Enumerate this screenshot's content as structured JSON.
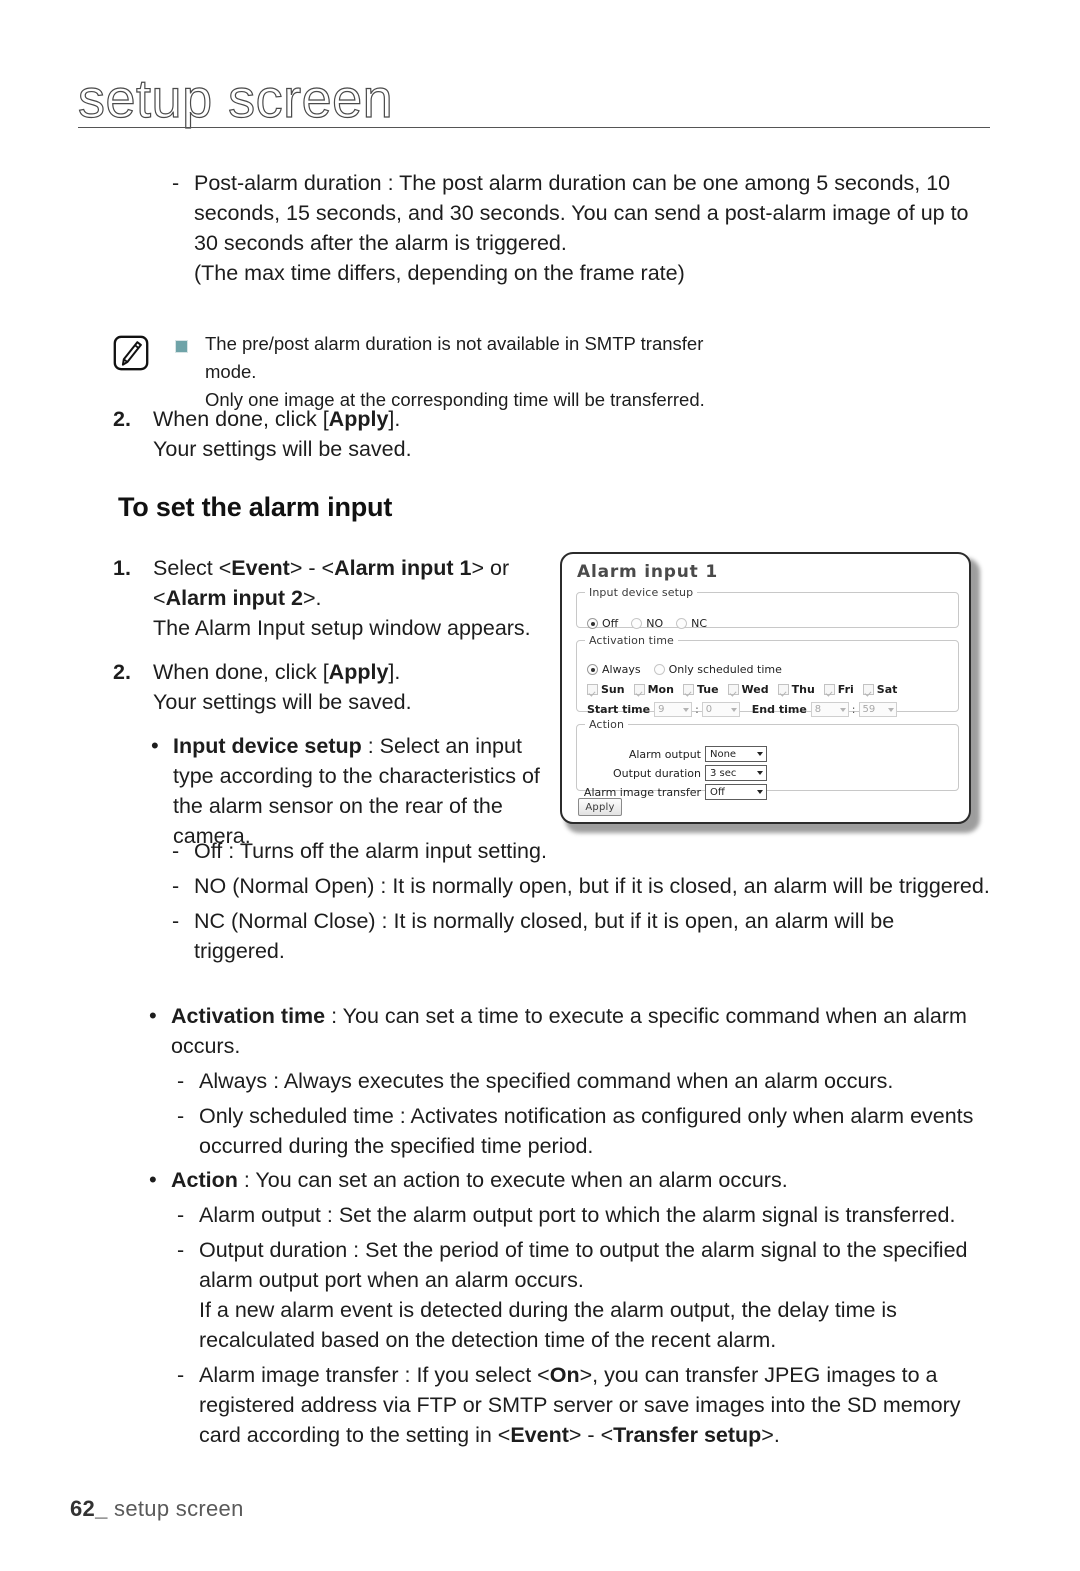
{
  "header": {
    "title": "setup screen"
  },
  "post_alarm": {
    "dash": "-",
    "line1": "Post-alarm duration : The post alarm duration can be one among 5 seconds, 10 seconds, 15 seconds, and 30 seconds. You can send a post-alarm image of up to 30 seconds after the alarm is triggered.",
    "line2": "(The max time differs, depending on the frame rate)"
  },
  "note": {
    "icon": "note-pencil-icon",
    "bullet": "square-bullet-icon",
    "line1": "The pre/post alarm duration is not available in SMTP transfer mode.",
    "line2": "Only one image at the corresponding time will be transferred.",
    "bullet_color": "#6fa3a8"
  },
  "step2_top": {
    "number": "2.",
    "text_pre": "When done, click [",
    "text_bold": "Apply",
    "text_post": "].",
    "sub": "Your settings will be saved."
  },
  "section": {
    "heading": "To set the alarm input"
  },
  "left_column": {
    "step1": {
      "number": "1.",
      "p1": "Select <",
      "b1": "Event",
      "p2": "> - <",
      "b2": "Alarm input 1",
      "p3": "> or",
      "p4": "<",
      "b3": "Alarm input 2",
      "p5": ">.",
      "sub": "The Alarm Input setup window appears."
    },
    "step2": {
      "number": "2.",
      "text_pre": "When done, click [",
      "text_bold": "Apply",
      "text_post": "].",
      "sub": "Your settings will be saved."
    },
    "bullet1": {
      "bold": "Input device setup",
      "rest": " : Select an input type according to the characteristics of the alarm sensor on the rear of the camera."
    }
  },
  "input_types": [
    {
      "dash": "-",
      "text": "Off : Turns off the alarm input setting."
    },
    {
      "dash": "-",
      "text": "NO (Normal Open) : It is normally open, but if it is closed, an alarm will be triggered."
    },
    {
      "dash": "-",
      "text": "NC (Normal Close) : It is normally closed, but if it is open, an alarm will be triggered."
    }
  ],
  "activation": {
    "bold": "Activation time",
    "rest": " : You can set a time to execute a specific command when an alarm occurs.",
    "sub": [
      {
        "dash": "-",
        "text": "Always : Always executes the specified command when an alarm occurs."
      },
      {
        "dash": "-",
        "text": "Only scheduled time : Activates notification as configured only when alarm events occurred during the specified time period."
      }
    ]
  },
  "action": {
    "bold": "Action",
    "rest": " : You can set an action to execute when an alarm occurs.",
    "sub1": {
      "dash": "-",
      "text": "Alarm output : Set the alarm output port to which the alarm signal is transferred."
    },
    "sub2": {
      "dash": "-",
      "line1": "Output duration : Set the period of time to output the alarm signal to the specified alarm output port when an alarm occurs.",
      "line2": "If a new alarm event is detected during the alarm output, the delay time is recalculated based on the detection time of the recent alarm."
    },
    "sub3": {
      "dash": "-",
      "p1": "Alarm image transfer : If you select <",
      "b1": "On",
      "p2": ">, you can transfer JPEG images to a registered address via FTP or SMTP server or save images into the SD memory card according to the setting in <",
      "b2": "Event",
      "p3": "> - <",
      "b3": "Transfer setup",
      "p4": ">."
    }
  },
  "dialog": {
    "title": "Alarm input 1",
    "input_device_setup": {
      "legend": "Input device setup",
      "options": [
        {
          "label": "Off",
          "selected": true
        },
        {
          "label": "NO",
          "selected": false
        },
        {
          "label": "NC",
          "selected": false
        }
      ]
    },
    "activation_time": {
      "legend": "Activation time",
      "modes": [
        {
          "label": "Always",
          "selected": true
        },
        {
          "label": "Only scheduled time",
          "selected": false
        }
      ],
      "days": [
        {
          "label": "Sun",
          "checked": true
        },
        {
          "label": "Mon",
          "checked": true
        },
        {
          "label": "Tue",
          "checked": true
        },
        {
          "label": "Wed",
          "checked": true
        },
        {
          "label": "Thu",
          "checked": true
        },
        {
          "label": "Fri",
          "checked": true
        },
        {
          "label": "Sat",
          "checked": true
        }
      ],
      "start_label": "Start time",
      "start_hour": "9",
      "start_min": "0",
      "end_label": "End time",
      "end_hour": "8",
      "end_min": "59",
      "colon": ":"
    },
    "action": {
      "legend": "Action",
      "rows": [
        {
          "label": "Alarm output",
          "value": "None"
        },
        {
          "label": "Output duration",
          "value": "3 sec"
        },
        {
          "label": "Alarm image transfer",
          "value": "Off"
        }
      ]
    },
    "apply_label": "Apply"
  },
  "footer": {
    "page": "62",
    "underscore": "_",
    "label": "setup screen"
  }
}
